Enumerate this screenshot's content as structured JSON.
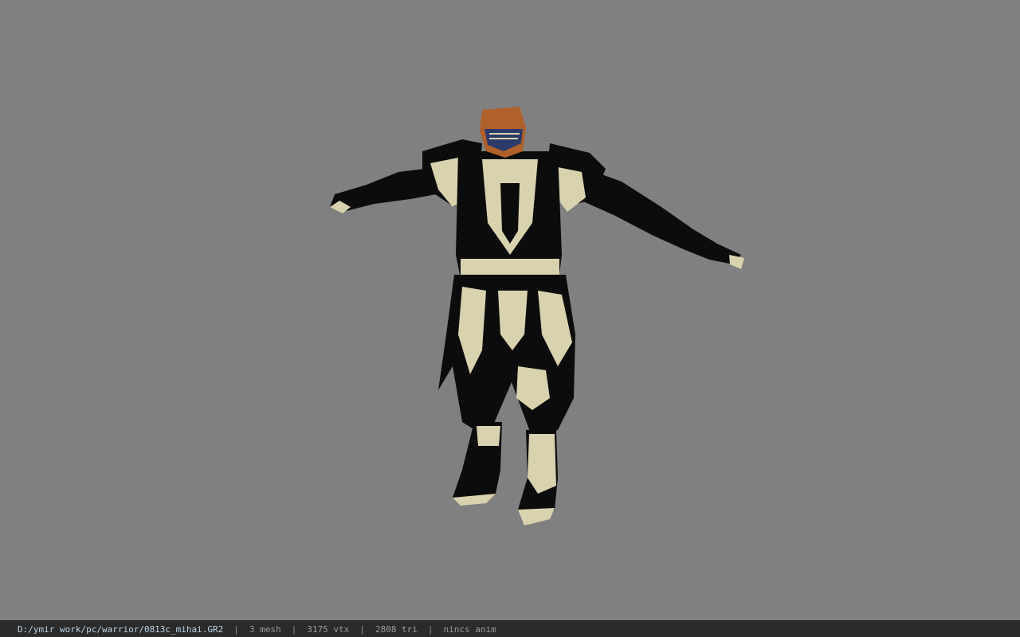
{
  "viewport": {
    "background": "#808080",
    "model_description": "warrior-armor-tpose"
  },
  "statusbar": {
    "file_path": "D:/ymir work/pc/warrior/0813c_mihai.GR2",
    "separator": "|",
    "mesh_count": "3 mesh",
    "vertex_count": "3175 vtx",
    "triangle_count": "2808 tri",
    "animation": "nincs anim"
  },
  "colors": {
    "armor_dark": "#0c0c0c",
    "armor_trim": "#d9d2ae",
    "helmet": "#b0602a",
    "status_path": "#bcd3e6"
  }
}
